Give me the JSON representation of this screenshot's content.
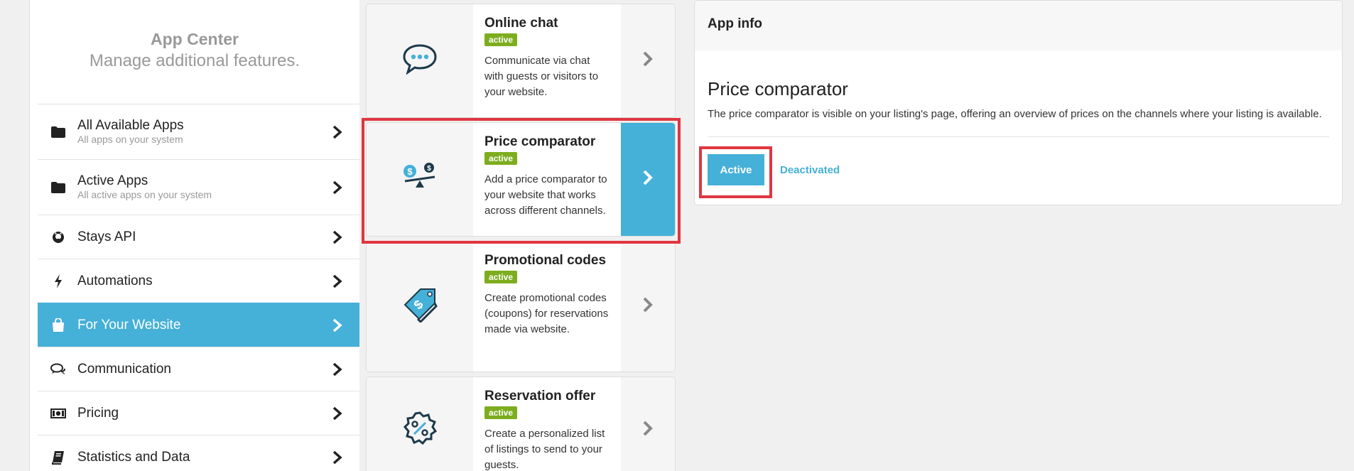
{
  "sidebar": {
    "title": "App Center",
    "subtitle": "Manage additional features.",
    "items": [
      {
        "label": "All Available Apps",
        "sub": "All apps on your system",
        "icon": "folder-icon"
      },
      {
        "label": "Active Apps",
        "sub": "All active apps on your system",
        "icon": "folder-icon"
      },
      {
        "label": "Stays API",
        "icon": "github-icon"
      },
      {
        "label": "Automations",
        "icon": "lightning-icon"
      },
      {
        "label": "For Your Website",
        "icon": "shopping-bag-icon",
        "active": true
      },
      {
        "label": "Communication",
        "icon": "chat-bubbles-icon"
      },
      {
        "label": "Pricing",
        "icon": "money-icon"
      },
      {
        "label": "Statistics and Data",
        "icon": "book-icon"
      }
    ]
  },
  "cards": [
    {
      "title": "Online chat",
      "badge": "active",
      "description": "Communicate via chat with guests or visitors to your website.",
      "icon": "chat-bubble-icon"
    },
    {
      "title": "Price comparator",
      "badge": "active",
      "description": "Add a price comparator to your website that works across different channels.",
      "icon": "scale-icon",
      "selected": true
    },
    {
      "title": "Promotional codes",
      "badge": "active",
      "description": "Create promotional codes (coupons) for reservations made via website.",
      "icon": "tag-icon"
    },
    {
      "title": "Reservation offer",
      "badge": "active",
      "description": "Create a personalized list of listings to send to your guests.",
      "icon": "percent-badge-icon"
    }
  ],
  "panel": {
    "header": "App info",
    "title": "Price comparator",
    "description": "The price comparator is visible on your listing's page, offering an overview of prices on the channels where your listing is available.",
    "active_label": "Active",
    "deactivated_label": "Deactivated"
  },
  "colors": {
    "accent": "#45b0d8",
    "badge": "#7dad1e",
    "highlight": "#e0363f"
  }
}
